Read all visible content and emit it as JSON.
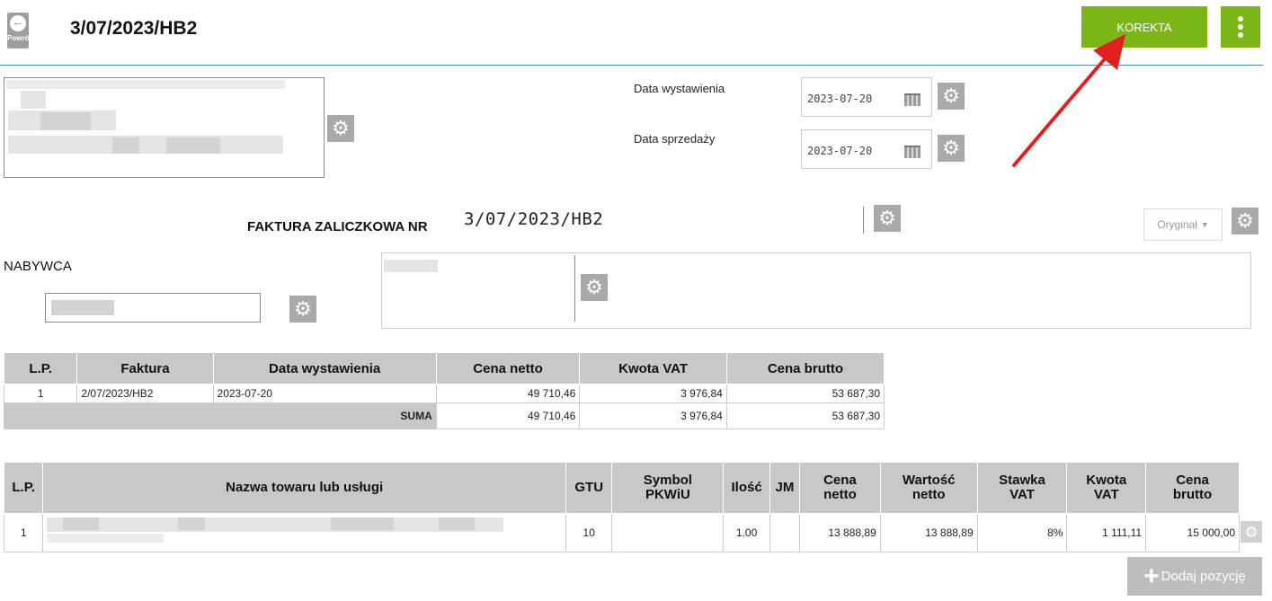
{
  "header": {
    "back_label": "Powrót",
    "title": "3/07/2023/HB2",
    "korekta_label": "KOREKTA"
  },
  "dates": {
    "issue_label": "Data wystawienia",
    "issue_value": "2023-07-20",
    "sale_label": "Data sprzedaży",
    "sale_value": "2023-07-20"
  },
  "invoice": {
    "type_label": "FAKTURA ZALICZKOWA NR",
    "number": "3/07/2023/HB2",
    "copy_select": "Oryginał"
  },
  "buyer": {
    "label": "NABYWCA"
  },
  "advance_table": {
    "headers": [
      "L.P.",
      "Faktura",
      "Data wystawienia",
      "Cena netto",
      "Kwota VAT",
      "Cena brutto"
    ],
    "rows": [
      {
        "lp": "1",
        "faktura": "2/07/2023/HB2",
        "data": "2023-07-20",
        "netto": "49 710,46",
        "vat": "3 976,84",
        "brutto": "53 687,30"
      }
    ],
    "sum": {
      "label": "SUMA",
      "netto": "49 710,46",
      "vat": "3 976,84",
      "brutto": "53 687,30"
    }
  },
  "items_table": {
    "headers": {
      "lp": "L.P.",
      "name": "Nazwa towaru lub usługi",
      "gtu": "GTU",
      "pkwiu_1": "Symbol",
      "pkwiu_2": "PKWiU",
      "qty": "Ilość",
      "unit": "JM",
      "net_price_1": "Cena",
      "net_price_2": "netto",
      "net_value_1": "Wartość",
      "net_value_2": "netto",
      "vat_rate_1": "Stawka",
      "vat_rate_2": "VAT",
      "vat_amount_1": "Kwota",
      "vat_amount_2": "VAT",
      "gross_1": "Cena",
      "gross_2": "brutto"
    },
    "rows": [
      {
        "lp": "1",
        "gtu": "10",
        "pkwiu": "",
        "qty": "1.00",
        "unit": "",
        "net_price": "13 888,89",
        "net_value": "13 888,89",
        "vat_rate": "8%",
        "vat_amount": "1 111,11",
        "gross": "15 000,00"
      }
    ],
    "add_label": "Dodaj pozycję"
  },
  "colors": {
    "accent_green": "#7cb518",
    "header_line": "#4a8ab0",
    "arrow_red": "#e02020",
    "gear_gray": "#a9a9a9"
  },
  "icons": {
    "back": "back-arrow-icon",
    "menu": "kebab-menu-icon",
    "gear": "gear-icon",
    "calendar": "calendar-icon",
    "add": "plus-icon"
  }
}
